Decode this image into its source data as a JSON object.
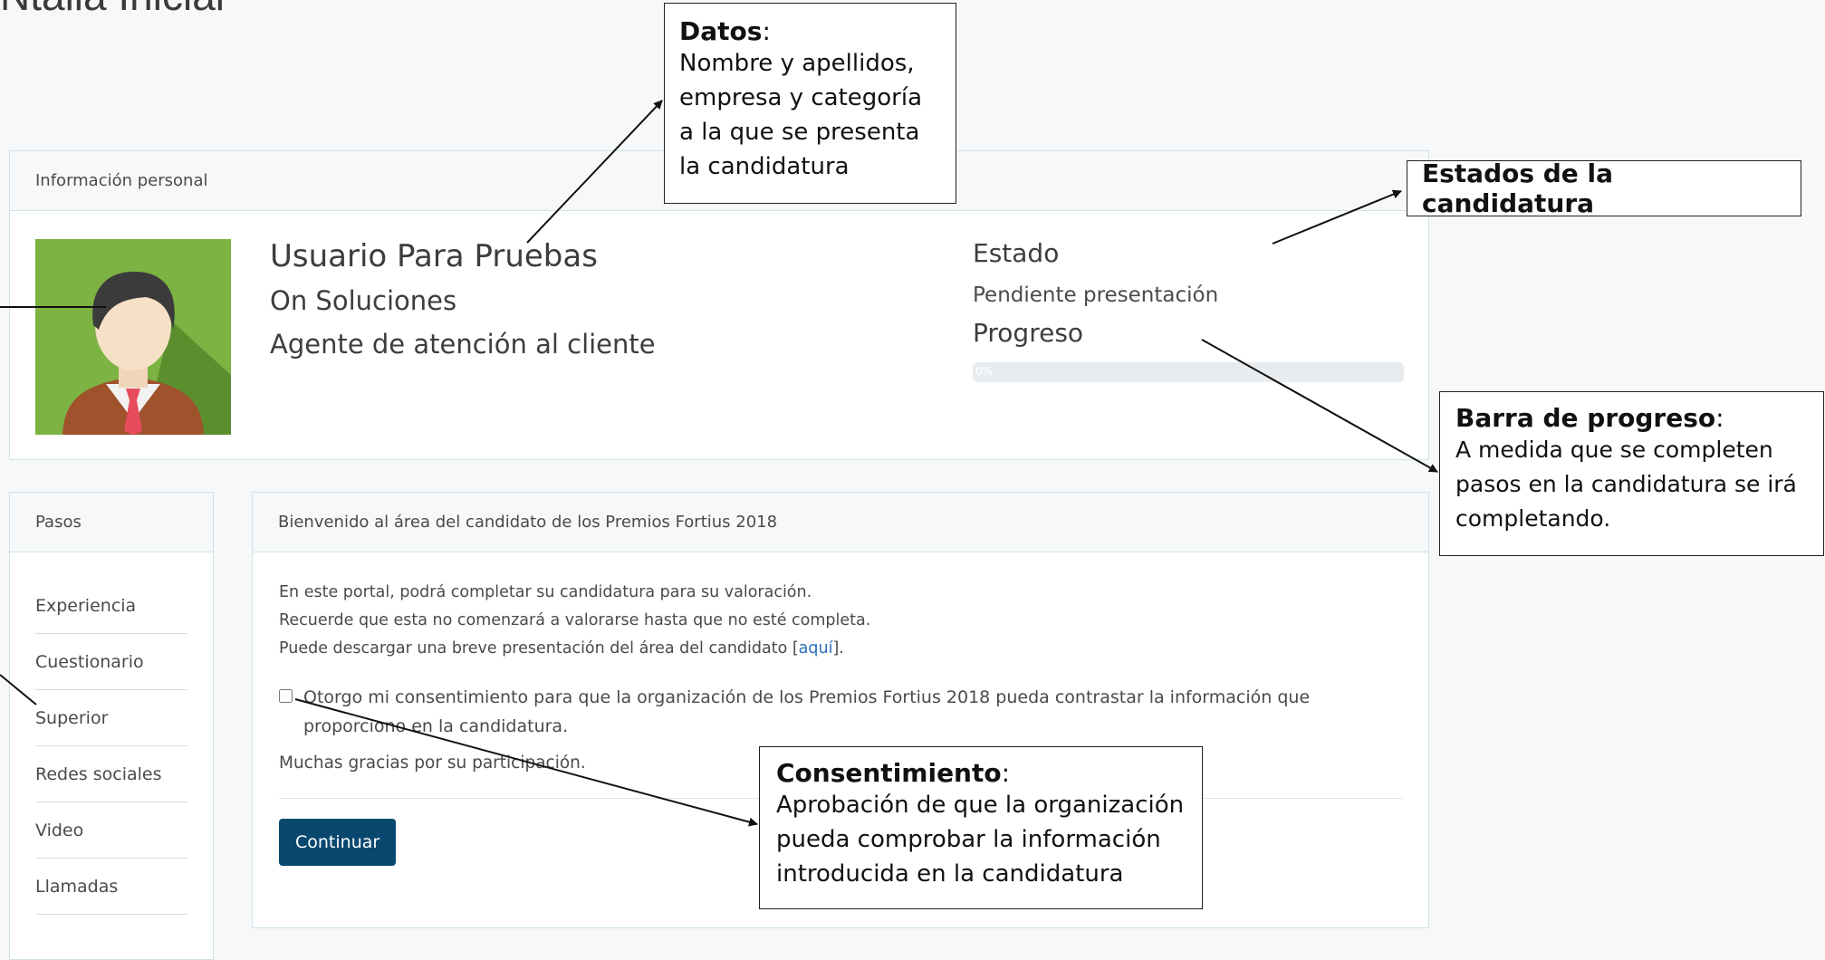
{
  "page": {
    "heading_fragment": "Ntalla Inicial"
  },
  "personal_info": {
    "header": "Información personal",
    "name": "Usuario Para Pruebas",
    "company": "On Soluciones",
    "category": "Agente de atención al cliente",
    "status_label": "Estado",
    "status_value": "Pendiente presentación",
    "progress_label": "Progreso",
    "progress_text": "0%",
    "progress_fraction": 0
  },
  "steps": {
    "header": "Pasos",
    "items": [
      {
        "label": "Experiencia"
      },
      {
        "label": "Cuestionario"
      },
      {
        "label": "Superior"
      },
      {
        "label": "Redes sociales"
      },
      {
        "label": "Video"
      },
      {
        "label": "Llamadas"
      }
    ]
  },
  "welcome": {
    "header": "Bienvenido al área del candidato de los Premios Fortius 2018",
    "line1": "En este portal, podrá completar su candidatura para su valoración.",
    "line2": "Recuerde que esta no comenzará a valorarse hasta que no esté completa.",
    "line3_prefix": "Puede descargar una breve presentación del área del candidato [",
    "line3_link": "aquí",
    "line3_suffix": "].",
    "consent_text": "Otorgo mi consentimiento para que la organización de los Premios Fortius 2018 pueda contrastar la información que proporciono en la candidatura.",
    "consent_checked": false,
    "thanks": "Muchas gracias por su participación.",
    "continue_label": "Continuar"
  },
  "callouts": {
    "datos": {
      "title": "Datos",
      "colon": ":",
      "text_lines": [
        "Nombre y apellidos,",
        "empresa y categoría",
        "a la que se presenta",
        "la candidatura"
      ]
    },
    "estados": {
      "title": "Estados de la candidatura"
    },
    "barra": {
      "title": "Barra de progreso",
      "colon": ":",
      "text_lines": [
        "A medida que se completen",
        "pasos en la candidatura se irá",
        "completando."
      ]
    },
    "consentimiento": {
      "title": "Consentimiento",
      "colon": ":",
      "text_lines": [
        "Aprobación de que la organización",
        "pueda comprobar la información",
        "introducida en la candidatura"
      ]
    }
  },
  "colors": {
    "button": "#08486e",
    "card_border": "#cfe3e6",
    "avatar_bg": "#7cb342",
    "link": "#2a6fbf"
  }
}
